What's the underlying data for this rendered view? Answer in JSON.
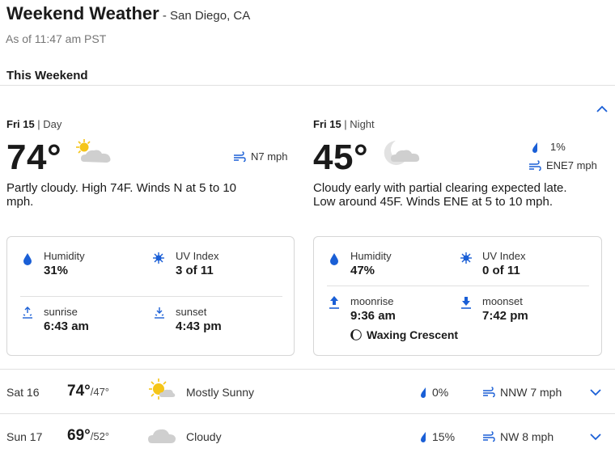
{
  "header": {
    "title": "Weekend Weather",
    "location": " - San Diego, CA",
    "as_of": "As of 11:47 am PST"
  },
  "section": {
    "title": "This Weekend"
  },
  "day": {
    "date": "Fri 15",
    "period": " | Day",
    "temp": "74°",
    "wind": "N7 mph",
    "description": "Partly cloudy. High 74F. Winds N at 5 to 10 mph.",
    "humidity_label": "Humidity",
    "humidity": "31%",
    "uv_label": "UV Index",
    "uv": "3 of 11",
    "sunrise_label": "sunrise",
    "sunrise": "6:43 am",
    "sunset_label": "sunset",
    "sunset": "4:43 pm"
  },
  "night": {
    "date": "Fri 15",
    "period": " | Night",
    "temp": "45°",
    "precip": "1%",
    "wind": "ENE7 mph",
    "description": "Cloudy early with partial clearing expected late. Low around 45F. Winds ENE at 5 to 10 mph.",
    "humidity_label": "Humidity",
    "humidity": "47%",
    "uv_label": "UV Index",
    "uv": "0 of 11",
    "moonrise_label": "moonrise",
    "moonrise": "9:36 am",
    "moonset_label": "moonset",
    "moonset": "7:42 pm",
    "moon_phase": "Waxing Crescent"
  },
  "forecast": [
    {
      "day": "Sat 16",
      "high": "74°",
      "low": "/47°",
      "condition": "Mostly Sunny",
      "precip": "0%",
      "wind": "NNW 7 mph",
      "icon": "mostly-sunny-icon"
    },
    {
      "day": "Sun 17",
      "high": "69°",
      "low": "/52°",
      "condition": "Cloudy",
      "precip": "15%",
      "wind": "NW 8 mph",
      "icon": "cloudy-icon"
    }
  ],
  "colors": {
    "accent": "#1a5fd6",
    "sun": "#f5c518",
    "cloud": "#c8c8c8"
  }
}
